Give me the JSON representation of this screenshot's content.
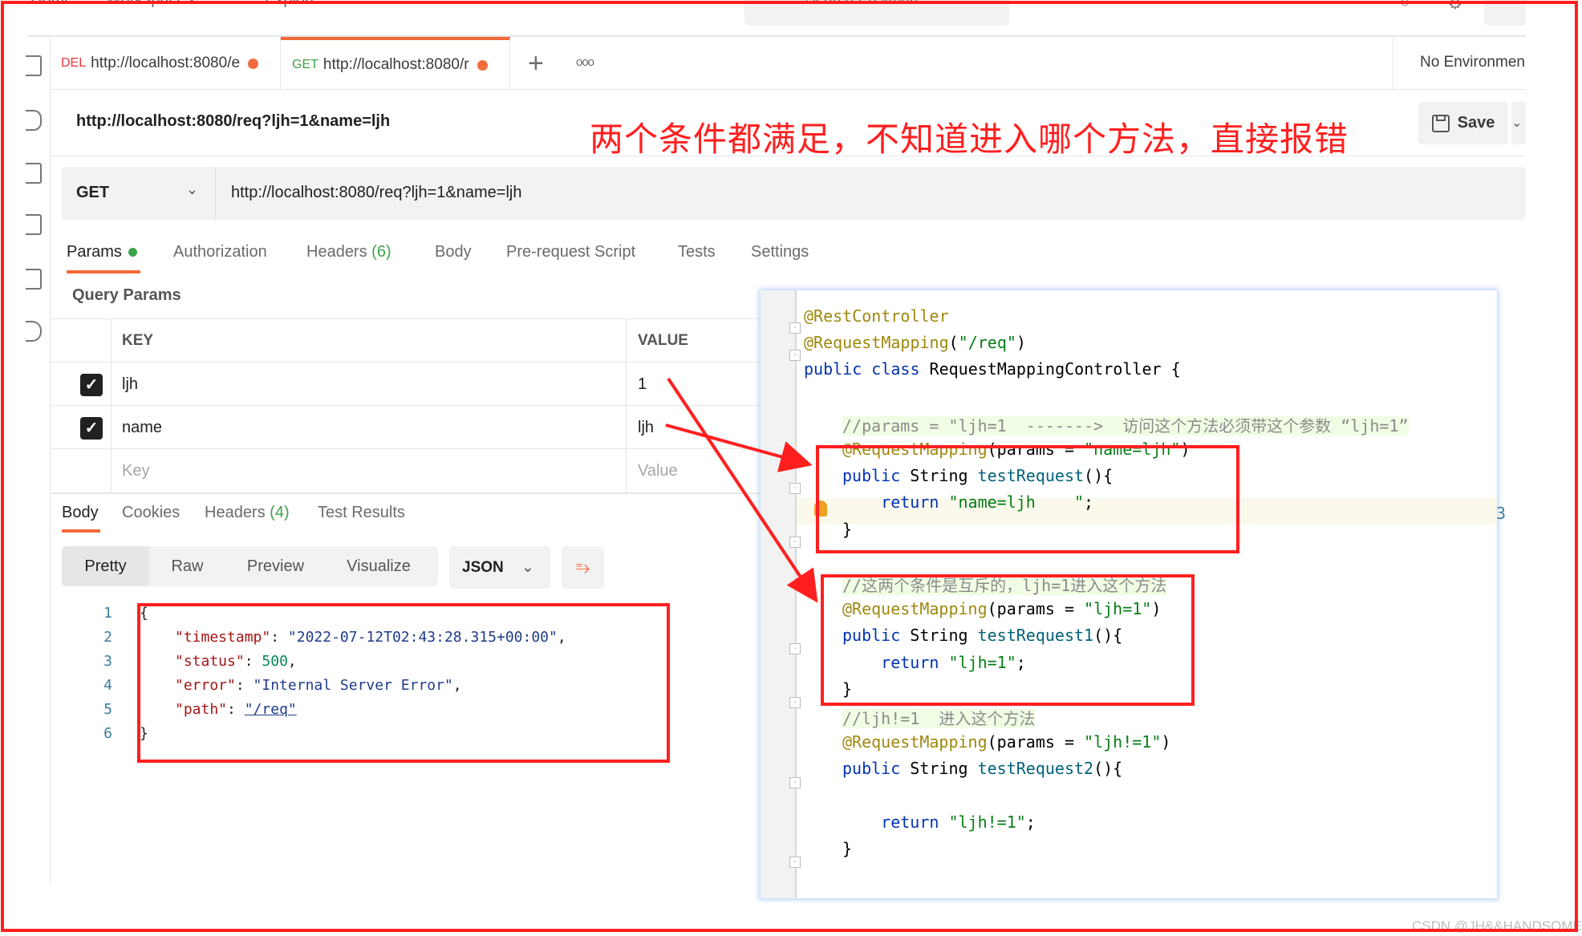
{
  "topnav": {
    "items": [
      "Home",
      "Workspaces",
      "Explore"
    ],
    "search_placeholder": "Search Postman"
  },
  "tabs": [
    {
      "method": "DEL",
      "label": "http://localhost:8080/e",
      "unsaved": true,
      "active": false
    },
    {
      "method": "GET",
      "label": "http://localhost:8080/r",
      "unsaved": true,
      "active": true
    }
  ],
  "tabbar": {
    "new_tab": "+",
    "more": "ooo",
    "environment": "No Environmen"
  },
  "request": {
    "name": "http://localhost:8080/req?ljh=1&name=ljh",
    "method": "GET",
    "url": "http://localhost:8080/req?ljh=1&name=ljh",
    "save_label": "Save"
  },
  "annotation": "两个条件都满足，不知道进入哪个方法，直接报错",
  "param_tabs": [
    {
      "label": "Params",
      "active": true,
      "indicator": true
    },
    {
      "label": "Authorization"
    },
    {
      "label": "Headers",
      "count": "(6)"
    },
    {
      "label": "Body"
    },
    {
      "label": "Pre-request Script"
    },
    {
      "label": "Tests"
    },
    {
      "label": "Settings"
    }
  ],
  "query_params": {
    "title": "Query Params",
    "headers": {
      "key": "KEY",
      "value": "VALUE"
    },
    "rows": [
      {
        "checked": true,
        "key": "ljh",
        "value": "1"
      },
      {
        "checked": true,
        "key": "name",
        "value": "ljh"
      }
    ],
    "placeholder": {
      "key": "Key",
      "value": "Value"
    }
  },
  "response_tabs": [
    {
      "label": "Body",
      "active": true
    },
    {
      "label": "Cookies"
    },
    {
      "label": "Headers",
      "count": "(4)"
    },
    {
      "label": "Test Results"
    }
  ],
  "view_modes": [
    "Pretty",
    "Raw",
    "Preview",
    "Visualize"
  ],
  "format": "JSON",
  "response_body": {
    "line_numbers": [
      "1",
      "2",
      "3",
      "4",
      "5",
      "6"
    ],
    "open_brace": "{",
    "close_brace": "}",
    "fields": [
      {
        "key": "\"timestamp\"",
        "value": "\"2022-07-12T02:43:28.315+00:00\"",
        "type": "string",
        "trail": ","
      },
      {
        "key": "\"status\"",
        "value": "500",
        "type": "number",
        "trail": ","
      },
      {
        "key": "\"error\"",
        "value": "\"Internal Server Error\"",
        "type": "string",
        "trail": ","
      },
      {
        "key": "\"path\"",
        "value": "\"/req\"",
        "type": "link",
        "trail": ""
      }
    ]
  },
  "code": {
    "lines": [
      [
        {
          "t": "@RestController",
          "c": "ann"
        }
      ],
      [
        {
          "t": "@RequestMapping",
          "c": "ann"
        },
        {
          "t": "(",
          "c": "cls"
        },
        {
          "t": "\"/req\"",
          "c": "str"
        },
        {
          "t": ")",
          "c": "cls"
        }
      ],
      [
        {
          "t": "public class ",
          "c": "kw"
        },
        {
          "t": "RequestMappingController {",
          "c": "cls"
        }
      ],
      [],
      [
        {
          "t": "//params = \"ljh=1  -------> ",
          "c": "cm"
        },
        {
          "t": " 访问这个方法必须带这个参数 “ljh=1”",
          "c": "cm"
        }
      ],
      [
        {
          "t": "@RequestMapping",
          "c": "ann"
        },
        {
          "t": "(params = ",
          "c": "cls"
        },
        {
          "t": "\"name=ljh\"",
          "c": "str"
        },
        {
          "t": ")",
          "c": "cls"
        }
      ],
      [
        {
          "t": "public ",
          "c": "kw"
        },
        {
          "t": "String ",
          "c": "cls"
        },
        {
          "t": "testRequest",
          "c": "fn"
        },
        {
          "t": "(){",
          "c": "cls"
        }
      ],
      [
        {
          "t": "    return ",
          "c": "kw"
        },
        {
          "t": "\"name=ljh    \"",
          "c": "str"
        },
        {
          "t": ";",
          "c": "cls"
        }
      ],
      [
        {
          "t": "}",
          "c": "cls"
        }
      ],
      [],
      [
        {
          "t": "//这两个条件是互斥的，ljh=1进入这个方法",
          "c": "cm"
        }
      ],
      [
        {
          "t": "@RequestMapping",
          "c": "ann"
        },
        {
          "t": "(params = ",
          "c": "cls"
        },
        {
          "t": "\"ljh=1\"",
          "c": "str"
        },
        {
          "t": ")",
          "c": "cls"
        }
      ],
      [
        {
          "t": "public ",
          "c": "kw"
        },
        {
          "t": "String ",
          "c": "cls"
        },
        {
          "t": "testRequest1",
          "c": "fn"
        },
        {
          "t": "(){",
          "c": "cls"
        }
      ],
      [
        {
          "t": "    return ",
          "c": "kw"
        },
        {
          "t": "\"ljh=1\"",
          "c": "str"
        },
        {
          "t": ";",
          "c": "cls"
        }
      ],
      [
        {
          "t": "}",
          "c": "cls"
        }
      ],
      [
        {
          "t": "//ljh!=1  进入这个方法",
          "c": "cm"
        }
      ],
      [
        {
          "t": "@RequestMapping",
          "c": "ann"
        },
        {
          "t": "(params = ",
          "c": "cls"
        },
        {
          "t": "\"ljh!=1\"",
          "c": "str"
        },
        {
          "t": ")",
          "c": "cls"
        }
      ],
      [
        {
          "t": "public ",
          "c": "kw"
        },
        {
          "t": "String ",
          "c": "cls"
        },
        {
          "t": "testRequest2",
          "c": "fn"
        },
        {
          "t": "(){",
          "c": "cls"
        }
      ],
      [],
      [
        {
          "t": "    return ",
          "c": "kw"
        },
        {
          "t": "\"ljh!=1\"",
          "c": "str"
        },
        {
          "t": ";",
          "c": "cls"
        }
      ],
      [
        {
          "t": "}",
          "c": "cls"
        }
      ]
    ],
    "edge_digit": "3"
  },
  "watermark": "CSDN @JH&&HANDSOME",
  "colors": {
    "accent": "#f26b3a",
    "annotation_red": "#ff1f1f",
    "get_green": "#3fa24b",
    "del_red": "#e8343b"
  }
}
